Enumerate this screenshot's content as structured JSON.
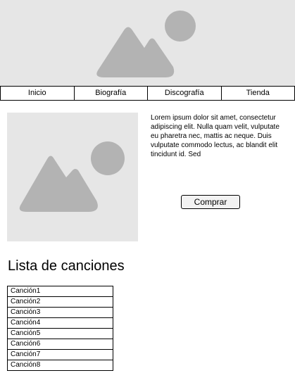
{
  "nav": {
    "items": [
      {
        "label": "Inicio"
      },
      {
        "label": "Biografía"
      },
      {
        "label": "Discografía"
      },
      {
        "label": "Tienda"
      }
    ]
  },
  "hero": {
    "image_icon": "image-placeholder-icon"
  },
  "album": {
    "image_icon": "image-placeholder-icon",
    "description": "Lorem ipsum dolor sit amet, consectetur adipiscing elit. Nulla quam velit, vulputate eu pharetra nec, mattis ac neque. Duis vulputate commodo lectus, ac blandit elit tincidunt id. Sed",
    "buy_label": "Comprar"
  },
  "songs": {
    "heading": "Lista de canciones",
    "items": [
      "Canción1",
      "Canción2",
      "Canción3",
      "Canción4",
      "Canción5",
      "Canción6",
      "Canción7",
      "Canción8"
    ]
  },
  "colors": {
    "placeholder_bg": "#e6e6e6",
    "placeholder_shape": "#b3b3b3",
    "border": "#000000"
  }
}
